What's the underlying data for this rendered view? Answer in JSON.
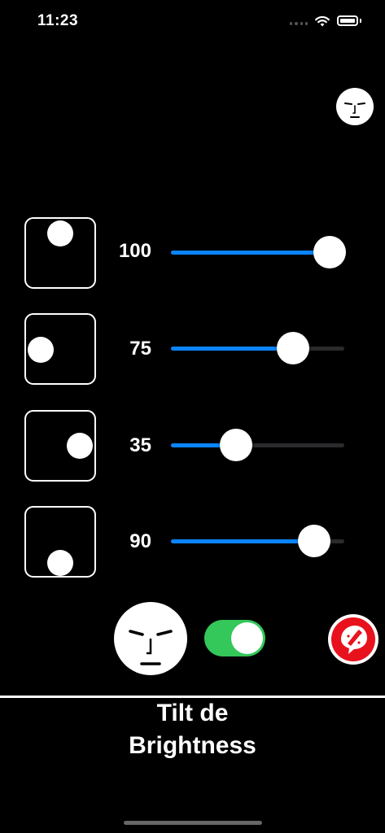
{
  "status_bar": {
    "time": "11:23"
  },
  "rows": [
    {
      "value": "100",
      "slider_fraction": 1.0
    },
    {
      "value": "75",
      "slider_fraction": 0.75
    },
    {
      "value": "35",
      "slider_fraction": 0.35
    },
    {
      "value": "90",
      "slider_fraction": 0.9
    }
  ],
  "toggle": {
    "on": true,
    "color": "#34c759"
  },
  "slider_colors": {
    "fill": "#0a84ff",
    "track": "#2a2a2c"
  },
  "footer": {
    "title_line1": "Tilt de",
    "title_line2": "Brightness"
  },
  "icons": {
    "header_face": "face-icon",
    "main_face": "face-icon",
    "record_button": "red-record-icon"
  }
}
